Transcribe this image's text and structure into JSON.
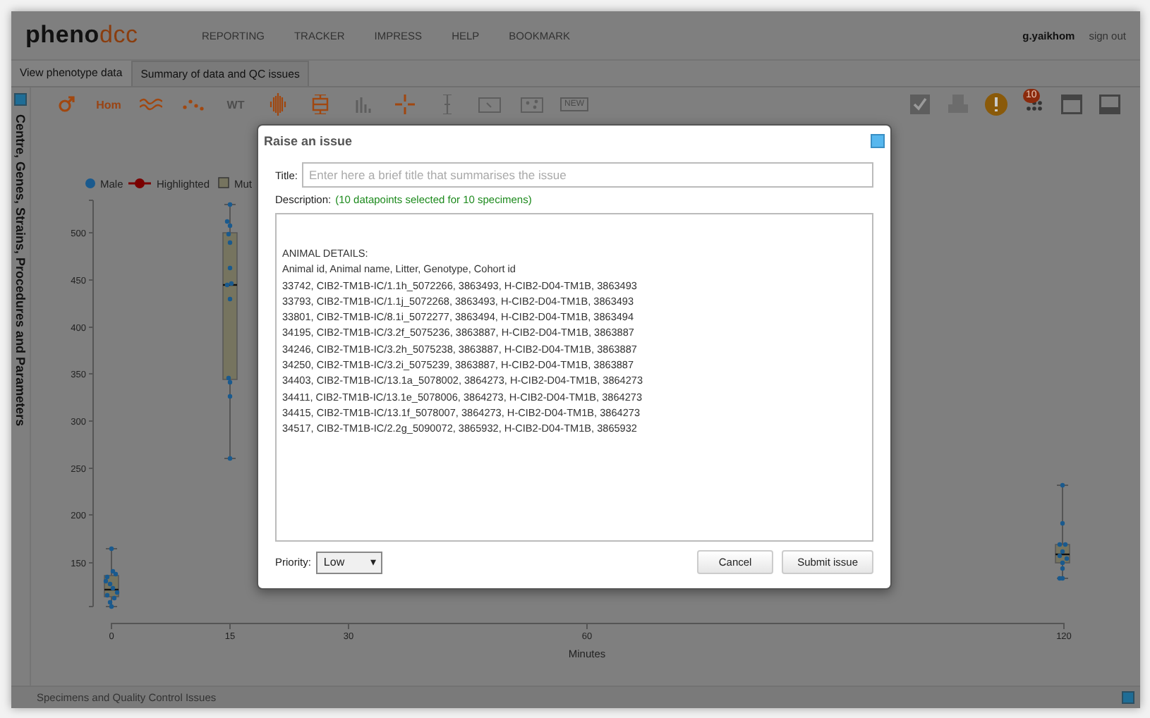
{
  "header": {
    "logo": {
      "first": "pheno",
      "second": "dcc"
    },
    "nav": [
      "REPORTING",
      "TRACKER",
      "IMPRESS",
      "HELP",
      "BOOKMARK"
    ],
    "user": "g.yaikhom",
    "signout": "sign out"
  },
  "tabs": [
    {
      "label": "View phenotype data",
      "selected": true
    },
    {
      "label": "Summary of data and QC issues",
      "selected": false
    }
  ],
  "toolbar": {
    "left": [
      {
        "kind": "icon",
        "active": true
      },
      {
        "kind": "label",
        "text": "Hom",
        "active": true
      },
      {
        "kind": "icon",
        "active": true
      },
      {
        "kind": "icon",
        "active": true
      },
      {
        "kind": "label",
        "text": "WT",
        "active": false
      },
      {
        "kind": "icon",
        "active": true
      },
      {
        "kind": "icon",
        "active": true
      },
      {
        "kind": "icon",
        "active": false
      },
      {
        "kind": "icon",
        "active": true
      },
      {
        "kind": "icon",
        "active": false
      },
      {
        "kind": "icon",
        "active": false
      },
      {
        "kind": "icon",
        "active": false
      },
      {
        "kind": "boxed",
        "text": "NEW",
        "active": false
      }
    ],
    "right": [
      {
        "kind": "icon"
      },
      {
        "kind": "icon"
      },
      {
        "kind": "icon"
      },
      {
        "kind": "icon",
        "badge": "10"
      },
      {
        "kind": "icon"
      },
      {
        "kind": "icon"
      }
    ]
  },
  "sidebar": {
    "title": "Centre, Genes, Strains, Procedures and Parameters"
  },
  "chart": {
    "legend": [
      {
        "kind": "dot",
        "label": "Male"
      },
      {
        "kind": "line",
        "label": "Highlighted"
      },
      {
        "kind": "box",
        "label": "Mut"
      }
    ],
    "yticks": [
      "500",
      "450",
      "400",
      "350",
      "300",
      "250",
      "200",
      "150"
    ],
    "xticks": [
      "0",
      "15",
      "30",
      "60",
      "120"
    ],
    "xlabel": "Minutes"
  },
  "footer": {
    "label": "Specimens and Quality Control Issues"
  },
  "dialog": {
    "title": "Raise an issue",
    "title_label": "Title:",
    "title_placeholder": "Enter here a brief title that summarises the issue",
    "description_label": "Description:",
    "description_note": "(10 datapoints selected for 10 specimens)",
    "description_lines": [
      "ANIMAL DETAILS:",
      "Animal id, Animal name, Litter, Genotype, Cohort id",
      "33742, CIB2-TM1B-IC/1.1h_5072266, 3863493, H-CIB2-D04-TM1B, 3863493",
      "33793, CIB2-TM1B-IC/1.1j_5072268, 3863493, H-CIB2-D04-TM1B, 3863493",
      "33801, CIB2-TM1B-IC/8.1i_5072277, 3863494, H-CIB2-D04-TM1B, 3863494",
      "34195, CIB2-TM1B-IC/3.2f_5075236, 3863887, H-CIB2-D04-TM1B, 3863887",
      "34246, CIB2-TM1B-IC/3.2h_5075238, 3863887, H-CIB2-D04-TM1B, 3863887",
      "34250, CIB2-TM1B-IC/3.2i_5075239, 3863887, H-CIB2-D04-TM1B, 3863887",
      "34403, CIB2-TM1B-IC/13.1a_5078002, 3864273, H-CIB2-D04-TM1B, 3864273",
      "34411, CIB2-TM1B-IC/13.1e_5078006, 3864273, H-CIB2-D04-TM1B, 3864273",
      "34415, CIB2-TM1B-IC/13.1f_5078007, 3864273, H-CIB2-D04-TM1B, 3864273",
      "34517, CIB2-TM1B-IC/2.2g_5090072, 3865932, H-CIB2-D04-TM1B, 3865932"
    ],
    "priority_label": "Priority:",
    "priority_value": "Low",
    "priority_caret": "▾",
    "buttons": [
      "Cancel",
      "Submit issue"
    ]
  }
}
